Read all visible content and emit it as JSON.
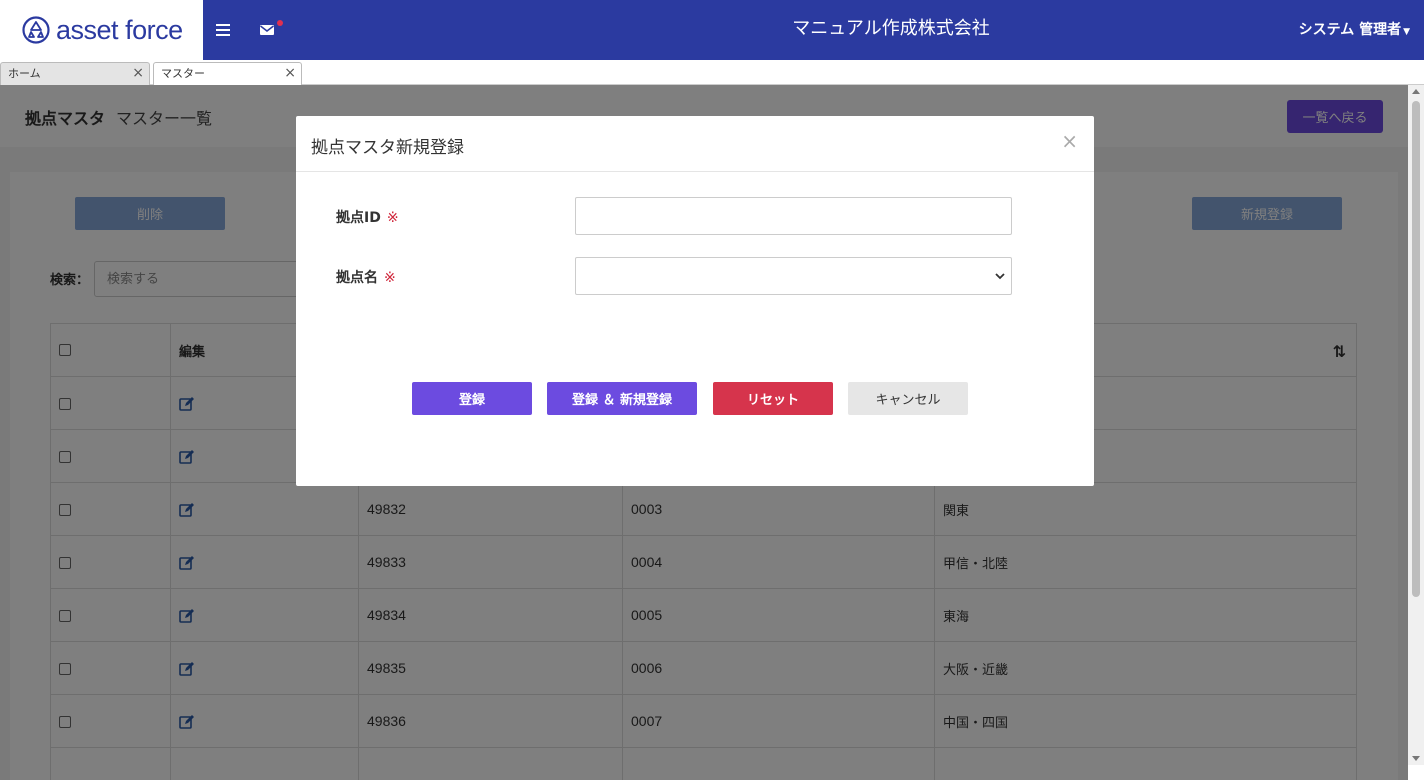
{
  "header": {
    "logo_asset": "asset",
    "logo_force": "force",
    "company": "マニュアル作成株式会社",
    "user": "システム 管理者",
    "menu_icon": "hamburger-icon",
    "mail_icon": "mail-icon"
  },
  "tabs": [
    {
      "label": "ホーム"
    },
    {
      "label": "マスター"
    }
  ],
  "page": {
    "title": "拠点マスタ",
    "subtitle": "マスター一覧",
    "back_label": "一覧へ戻る",
    "delete_label": "削除",
    "new_label": "新規登録",
    "search_label": "検索：",
    "search_placeholder": "検索する"
  },
  "table": {
    "header_edit": "編集",
    "rows": [
      {
        "id": "",
        "code": "",
        "name": ""
      },
      {
        "id": "",
        "code": "",
        "name": ""
      },
      {
        "id": "49832",
        "code": "0003",
        "name": "関東"
      },
      {
        "id": "49833",
        "code": "0004",
        "name": "甲信・北陸"
      },
      {
        "id": "49834",
        "code": "0005",
        "name": "東海"
      },
      {
        "id": "49835",
        "code": "0006",
        "name": "大阪・近畿"
      },
      {
        "id": "49836",
        "code": "0007",
        "name": "中国・四国"
      }
    ]
  },
  "modal": {
    "title": "拠点マスタ新規登録",
    "close": "×",
    "field1_label": "拠点ID",
    "field2_label": "拠点名",
    "required_mark": "※",
    "field1_value": "",
    "field2_value": "",
    "btn_register": "登録",
    "btn_register_new": "登録 ＆ 新規登録",
    "btn_reset": "リセット",
    "btn_cancel": "キャンセル"
  },
  "colors": {
    "header_bg": "#2b3aa0",
    "accent": "#6c4be0",
    "danger": "#d6344c"
  }
}
